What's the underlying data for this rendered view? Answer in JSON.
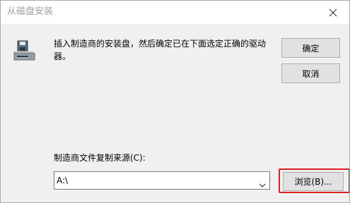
{
  "window": {
    "title": "从磁盘安装"
  },
  "message": {
    "text": "插入制造商的安装盘，然后确定已在下面选定正确的驱动器。"
  },
  "buttons": {
    "ok_label": "确定",
    "cancel_label": "取消",
    "browse_label": "浏览(B)..."
  },
  "source": {
    "label": "制造商文件复制来源(C):",
    "value": "A:\\"
  },
  "icons": {
    "close": "close-icon",
    "disk": "floppy-drive-icon",
    "dropdown": "chevron-down-icon"
  },
  "colors": {
    "highlight": "#e02020"
  }
}
